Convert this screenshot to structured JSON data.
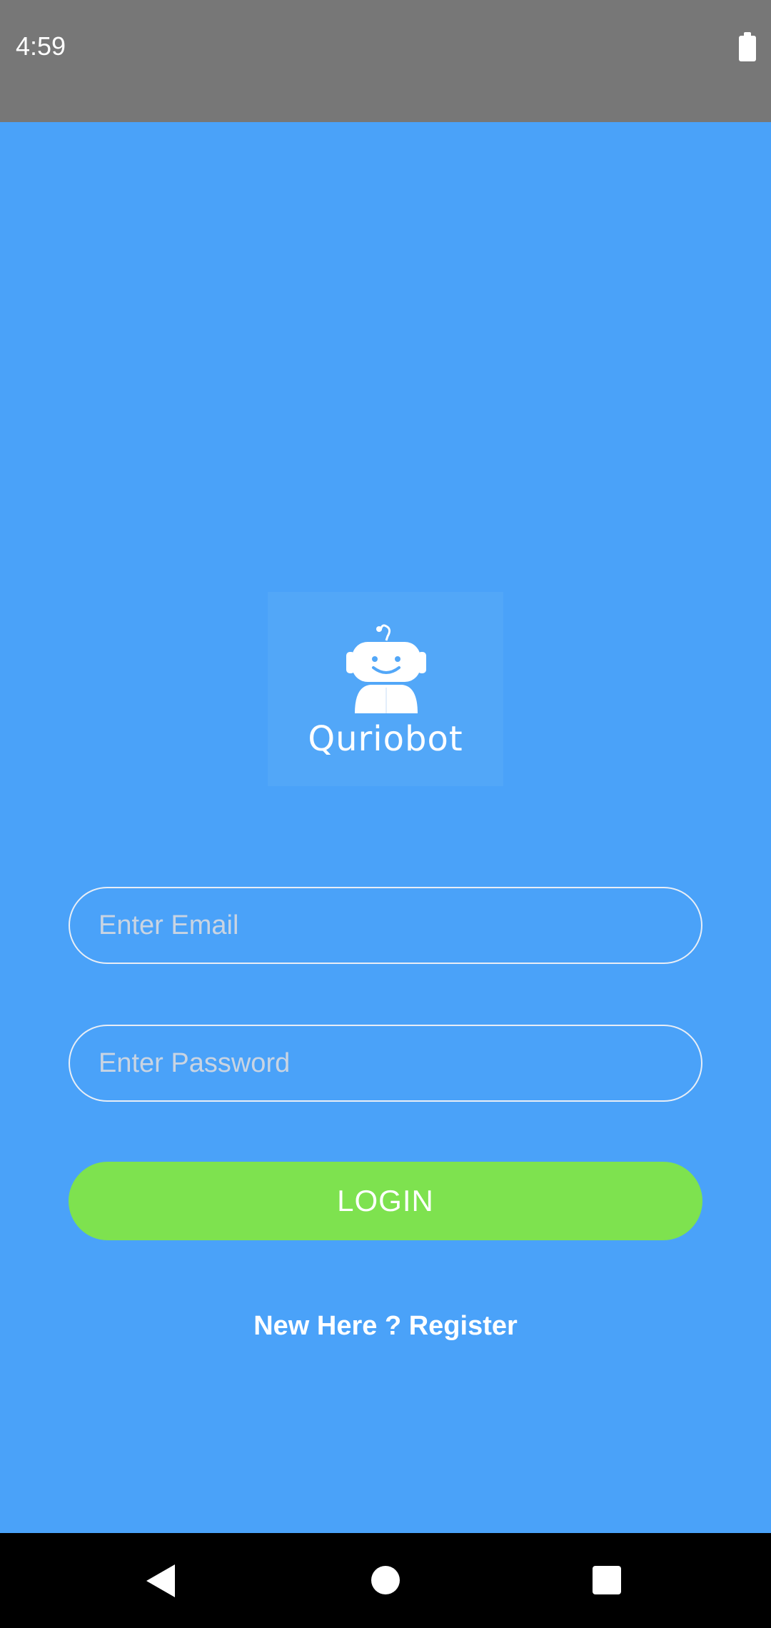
{
  "status_bar": {
    "time": "4:59",
    "battery_icon": "battery-full-icon"
  },
  "logo": {
    "icon": "robot-icon",
    "text": "Quriobot"
  },
  "form": {
    "email_placeholder": "Enter Email",
    "email_value": "",
    "password_placeholder": "Enter Password",
    "password_value": "",
    "login_label": "LOGIN",
    "register_label": "New Here ? Register"
  },
  "nav_bar": {
    "back_icon": "back-triangle-icon",
    "home_icon": "home-circle-icon",
    "recents_icon": "recents-square-icon"
  },
  "colors": {
    "background": "#4aa2f9",
    "status_bar": "#777777",
    "login_button": "#7ee24f",
    "nav_bar": "#000000"
  }
}
